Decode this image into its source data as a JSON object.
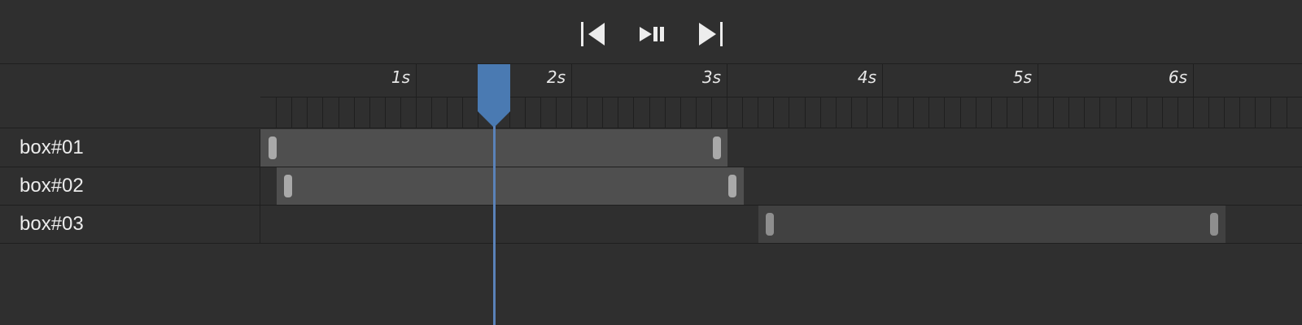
{
  "colors": {
    "background": "#2f2f2f",
    "grid_line": "#1f1f1f",
    "clip": "#4f4f4f",
    "clip_dim": "#414141",
    "handle": "#a9a9a9",
    "playhead": "#4a7ab2",
    "text": "#ececec"
  },
  "transport": {
    "buttons": [
      {
        "name": "skip-to-start",
        "icon": "skip-back-icon"
      },
      {
        "name": "play-pause",
        "icon": "play-pause-icon"
      },
      {
        "name": "skip-to-end",
        "icon": "skip-forward-icon"
      }
    ]
  },
  "ruler": {
    "seconds": [
      "1s",
      "2s",
      "3s",
      "4s",
      "5s",
      "6s"
    ]
  },
  "tracks": [
    {
      "name": "box#01"
    },
    {
      "name": "box#02"
    },
    {
      "name": "box#03"
    }
  ]
}
